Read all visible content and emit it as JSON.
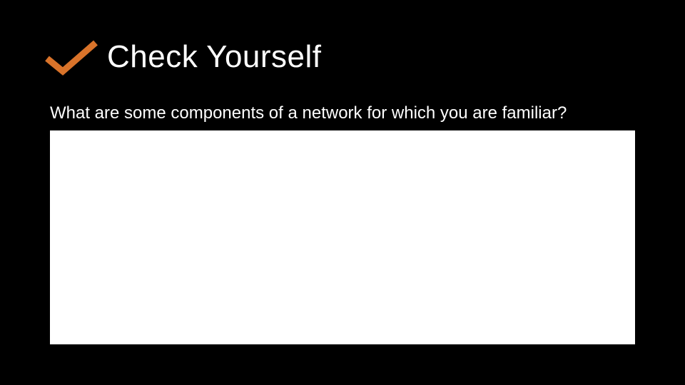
{
  "header": {
    "title": "Check Yourself",
    "icon": "checkmark-icon"
  },
  "content": {
    "question": "What are some components of a network for which you are familiar?",
    "answer": ""
  },
  "colors": {
    "accent": "#d9732a",
    "background": "#000000",
    "text": "#ffffff",
    "box": "#ffffff"
  }
}
